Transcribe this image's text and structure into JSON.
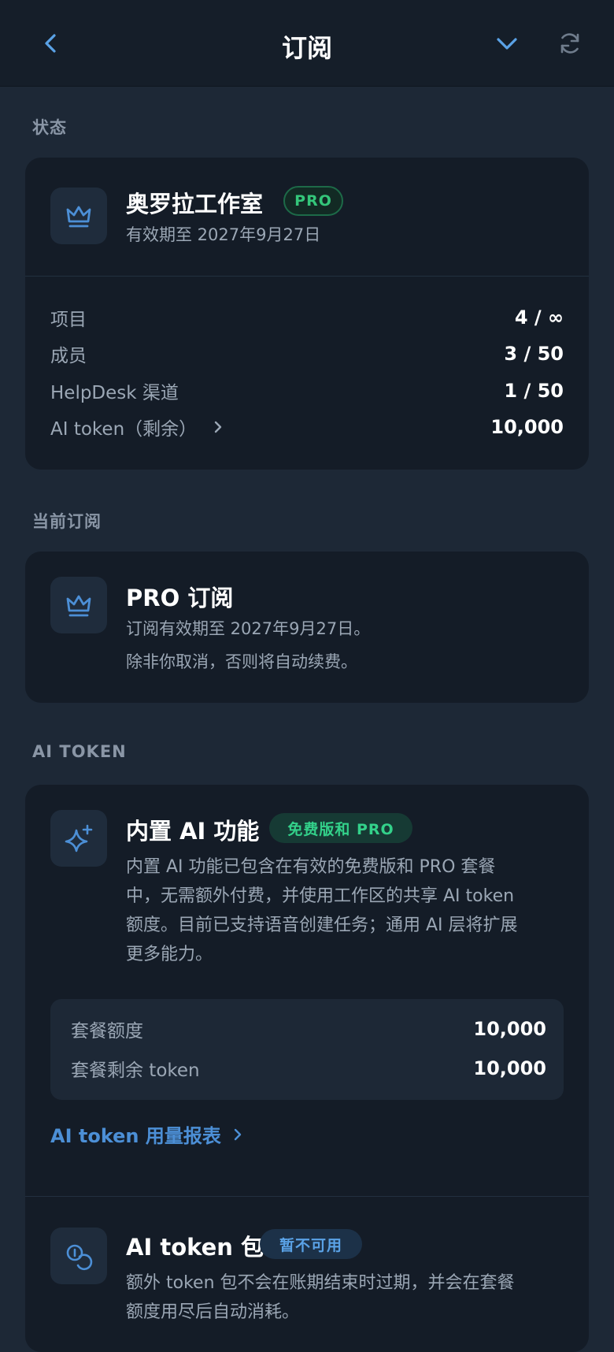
{
  "header": {
    "title": "订阅"
  },
  "sections": {
    "status": "状态",
    "current": "当前订阅",
    "ai": "AI TOKEN"
  },
  "status_card": {
    "org_name": "奥罗拉工作室",
    "badge": "PRO",
    "expiry": "有效期至 2027年9月27日",
    "rows": [
      {
        "label": "项目",
        "value": "4 / ∞"
      },
      {
        "label": "成员",
        "value": "3 / 50"
      },
      {
        "label": "HelpDesk 渠道",
        "value": "1 / 50"
      },
      {
        "label": "AI token（剩余）",
        "value": "10,000"
      }
    ]
  },
  "subscription_card": {
    "title": "PRO 订阅",
    "line1": "订阅有效期至 2027年9月27日。",
    "line2": "除非你取消，否则将自动续费。"
  },
  "ai_card": {
    "title": "内置 AI 功能",
    "badge": "免费版和 PRO",
    "desc_lines": [
      "内置 AI 功能已包含在有效的免费版和 PRO 套餐",
      "中，无需额外付费，并使用工作区的共享 AI token",
      "额度。目前已支持语音创建任务；通用 AI 层将扩展",
      "更多能力。"
    ],
    "quota_label": "套餐额度",
    "quota_value": "10,000",
    "remaining_label": "套餐剩余 token",
    "remaining_value": "10,000",
    "report_link": "AI token 用量报表",
    "pack_title": "AI token 包",
    "pack_badge": "暂不可用",
    "pack_desc_lines": [
      "额外 token 包不会在账期结束时过期，并会在套餐",
      "额度用尽后自动消耗。"
    ]
  },
  "icons": {
    "back": "chevron-left-icon",
    "collapse": "chevron-down-icon",
    "refresh": "refresh-icon",
    "crown": "crown-icon",
    "sparkle": "sparkle-icon",
    "coins": "coins-icon"
  },
  "colors": {
    "accent": "#4c8fd6",
    "pro_green": "#34c67a",
    "background": "#1d2836",
    "card": "#141c27"
  }
}
